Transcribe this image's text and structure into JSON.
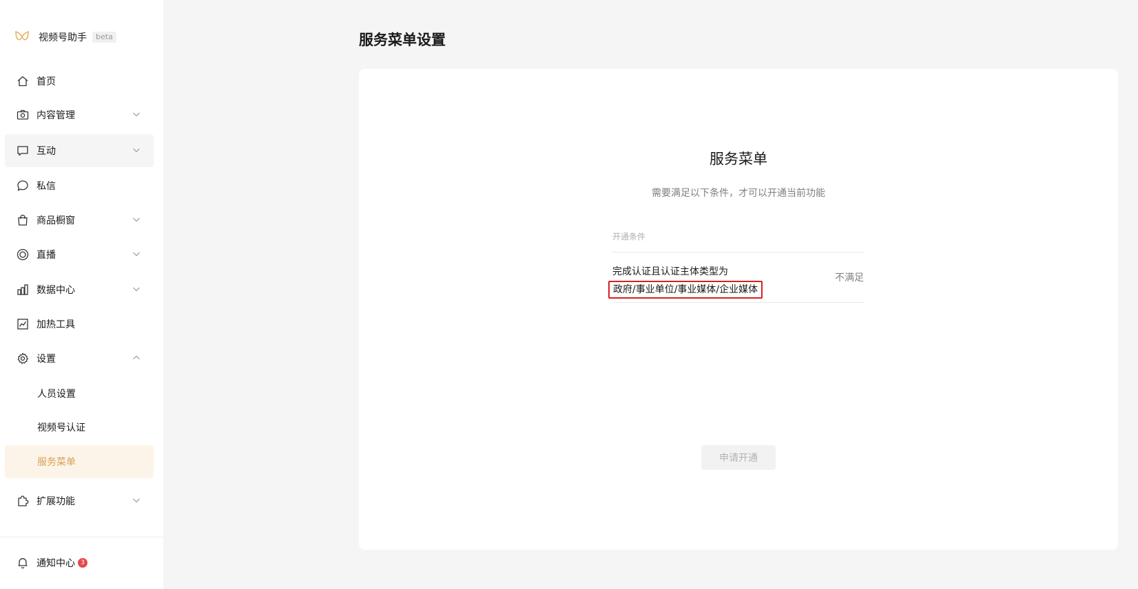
{
  "brand": {
    "name": "视频号助手",
    "beta": "beta"
  },
  "sidebar": {
    "items": [
      {
        "label": "首页",
        "icon": "home-icon"
      },
      {
        "label": "内容管理",
        "icon": "camera-icon"
      },
      {
        "label": "互动",
        "icon": "message-square-icon"
      },
      {
        "label": "私信",
        "icon": "chat-bubble-icon"
      },
      {
        "label": "商品橱窗",
        "icon": "shopping-bag-icon"
      },
      {
        "label": "直播",
        "icon": "live-icon"
      },
      {
        "label": "数据中心",
        "icon": "bar-chart-icon"
      },
      {
        "label": "加热工具",
        "icon": "trend-chart-icon"
      },
      {
        "label": "设置",
        "icon": "gear-icon"
      }
    ],
    "settings_sub": [
      {
        "label": "人员设置"
      },
      {
        "label": "视频号认证"
      },
      {
        "label": "服务菜单"
      }
    ],
    "extend": {
      "label": "扩展功能",
      "icon": "puzzle-icon"
    },
    "notice": {
      "label": "通知中心",
      "badge": "3",
      "icon": "bell-icon"
    }
  },
  "main": {
    "page_title": "服务菜单设置",
    "card": {
      "title": "服务菜单",
      "subtitle": "需要满足以下条件，才可以开通当前功能",
      "conditions_header": "开通条件",
      "condition_line1": "完成认证且认证主体类型为",
      "condition_line2": "政府/事业单位/事业媒体/企业媒体",
      "condition_status": "不满足",
      "apply_button": "申请开通"
    }
  },
  "colors": {
    "accent": "#d9a15a",
    "selected_bg": "#fdf4e9",
    "highlight_border": "#d8201f",
    "badge": "#e5484d"
  }
}
